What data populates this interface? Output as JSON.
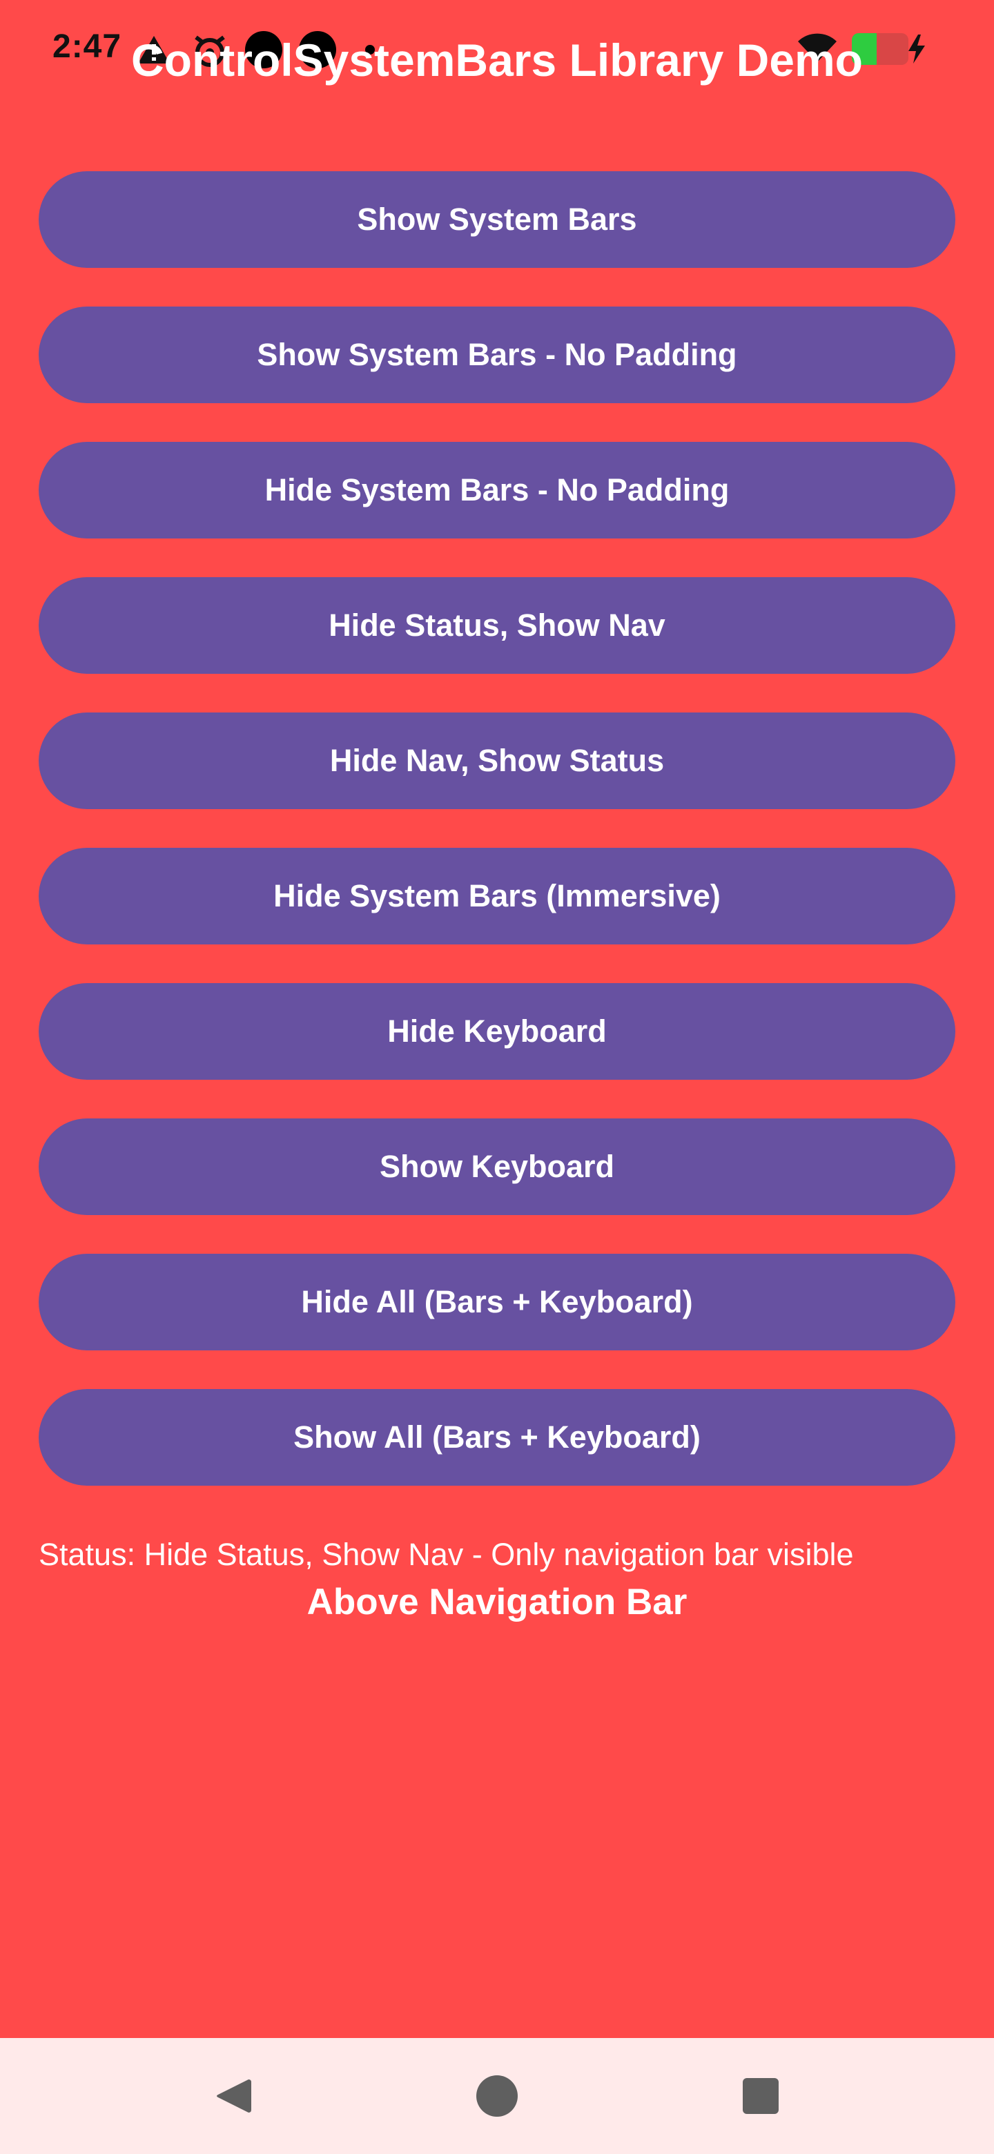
{
  "status_bar": {
    "time": "2:47",
    "icons_left": [
      "warning-icon",
      "alarm-icon",
      "notification-dot-icon",
      "notification-dot-icon",
      "small-dot-icon"
    ],
    "icons_right": [
      "wifi-icon",
      "battery-icon",
      "charging-bolt-icon"
    ]
  },
  "app": {
    "title": "ControlSystemBars Library Demo"
  },
  "buttons": [
    "Show System Bars",
    "Show System Bars - No Padding",
    "Hide System Bars - No Padding",
    "Hide Status, Show Nav",
    "Hide Nav, Show Status",
    "Hide System Bars (Immersive)",
    "Hide Keyboard",
    "Show Keyboard",
    "Hide All (Bars + Keyboard)",
    "Show All (Bars + Keyboard)"
  ],
  "status": {
    "text": "Status: Hide Status, Show Nav - Only navigation bar visible"
  },
  "footer_label": "Above Navigation Bar",
  "nav_bar": {
    "icons": [
      "back-icon",
      "home-icon",
      "recents-icon"
    ]
  },
  "colors": {
    "background": "#ff4a4a",
    "button": "#6751a1",
    "nav_bar": "#ffeaea",
    "battery_level": "#2ecc40"
  }
}
